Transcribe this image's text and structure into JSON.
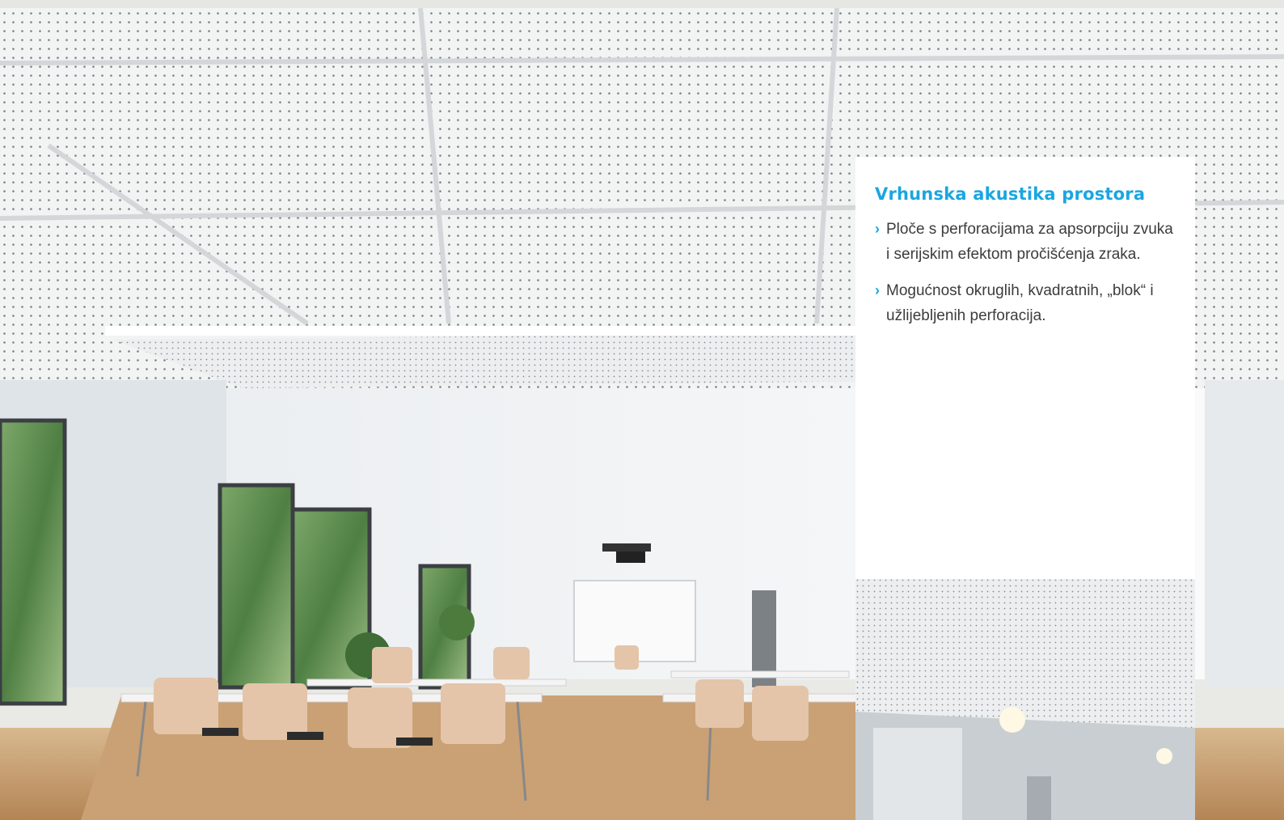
{
  "card": {
    "title": "Vrhunska akustika prostora",
    "bullets": [
      "Ploče s perforacijama za apsorpciju zvuka i serijskim efektom pročišćenja zraka.",
      "Mogućnost okruglih, kvadratnih, „blok“ i užlijebljenih perforacija."
    ],
    "bullet_marker": "›"
  },
  "colors": {
    "accent": "#1aa6e0",
    "ceiling": "#f1f2f2",
    "floor": "#c39a6a",
    "chair": "#e2c3a8",
    "wall": "#f6f6f6"
  }
}
